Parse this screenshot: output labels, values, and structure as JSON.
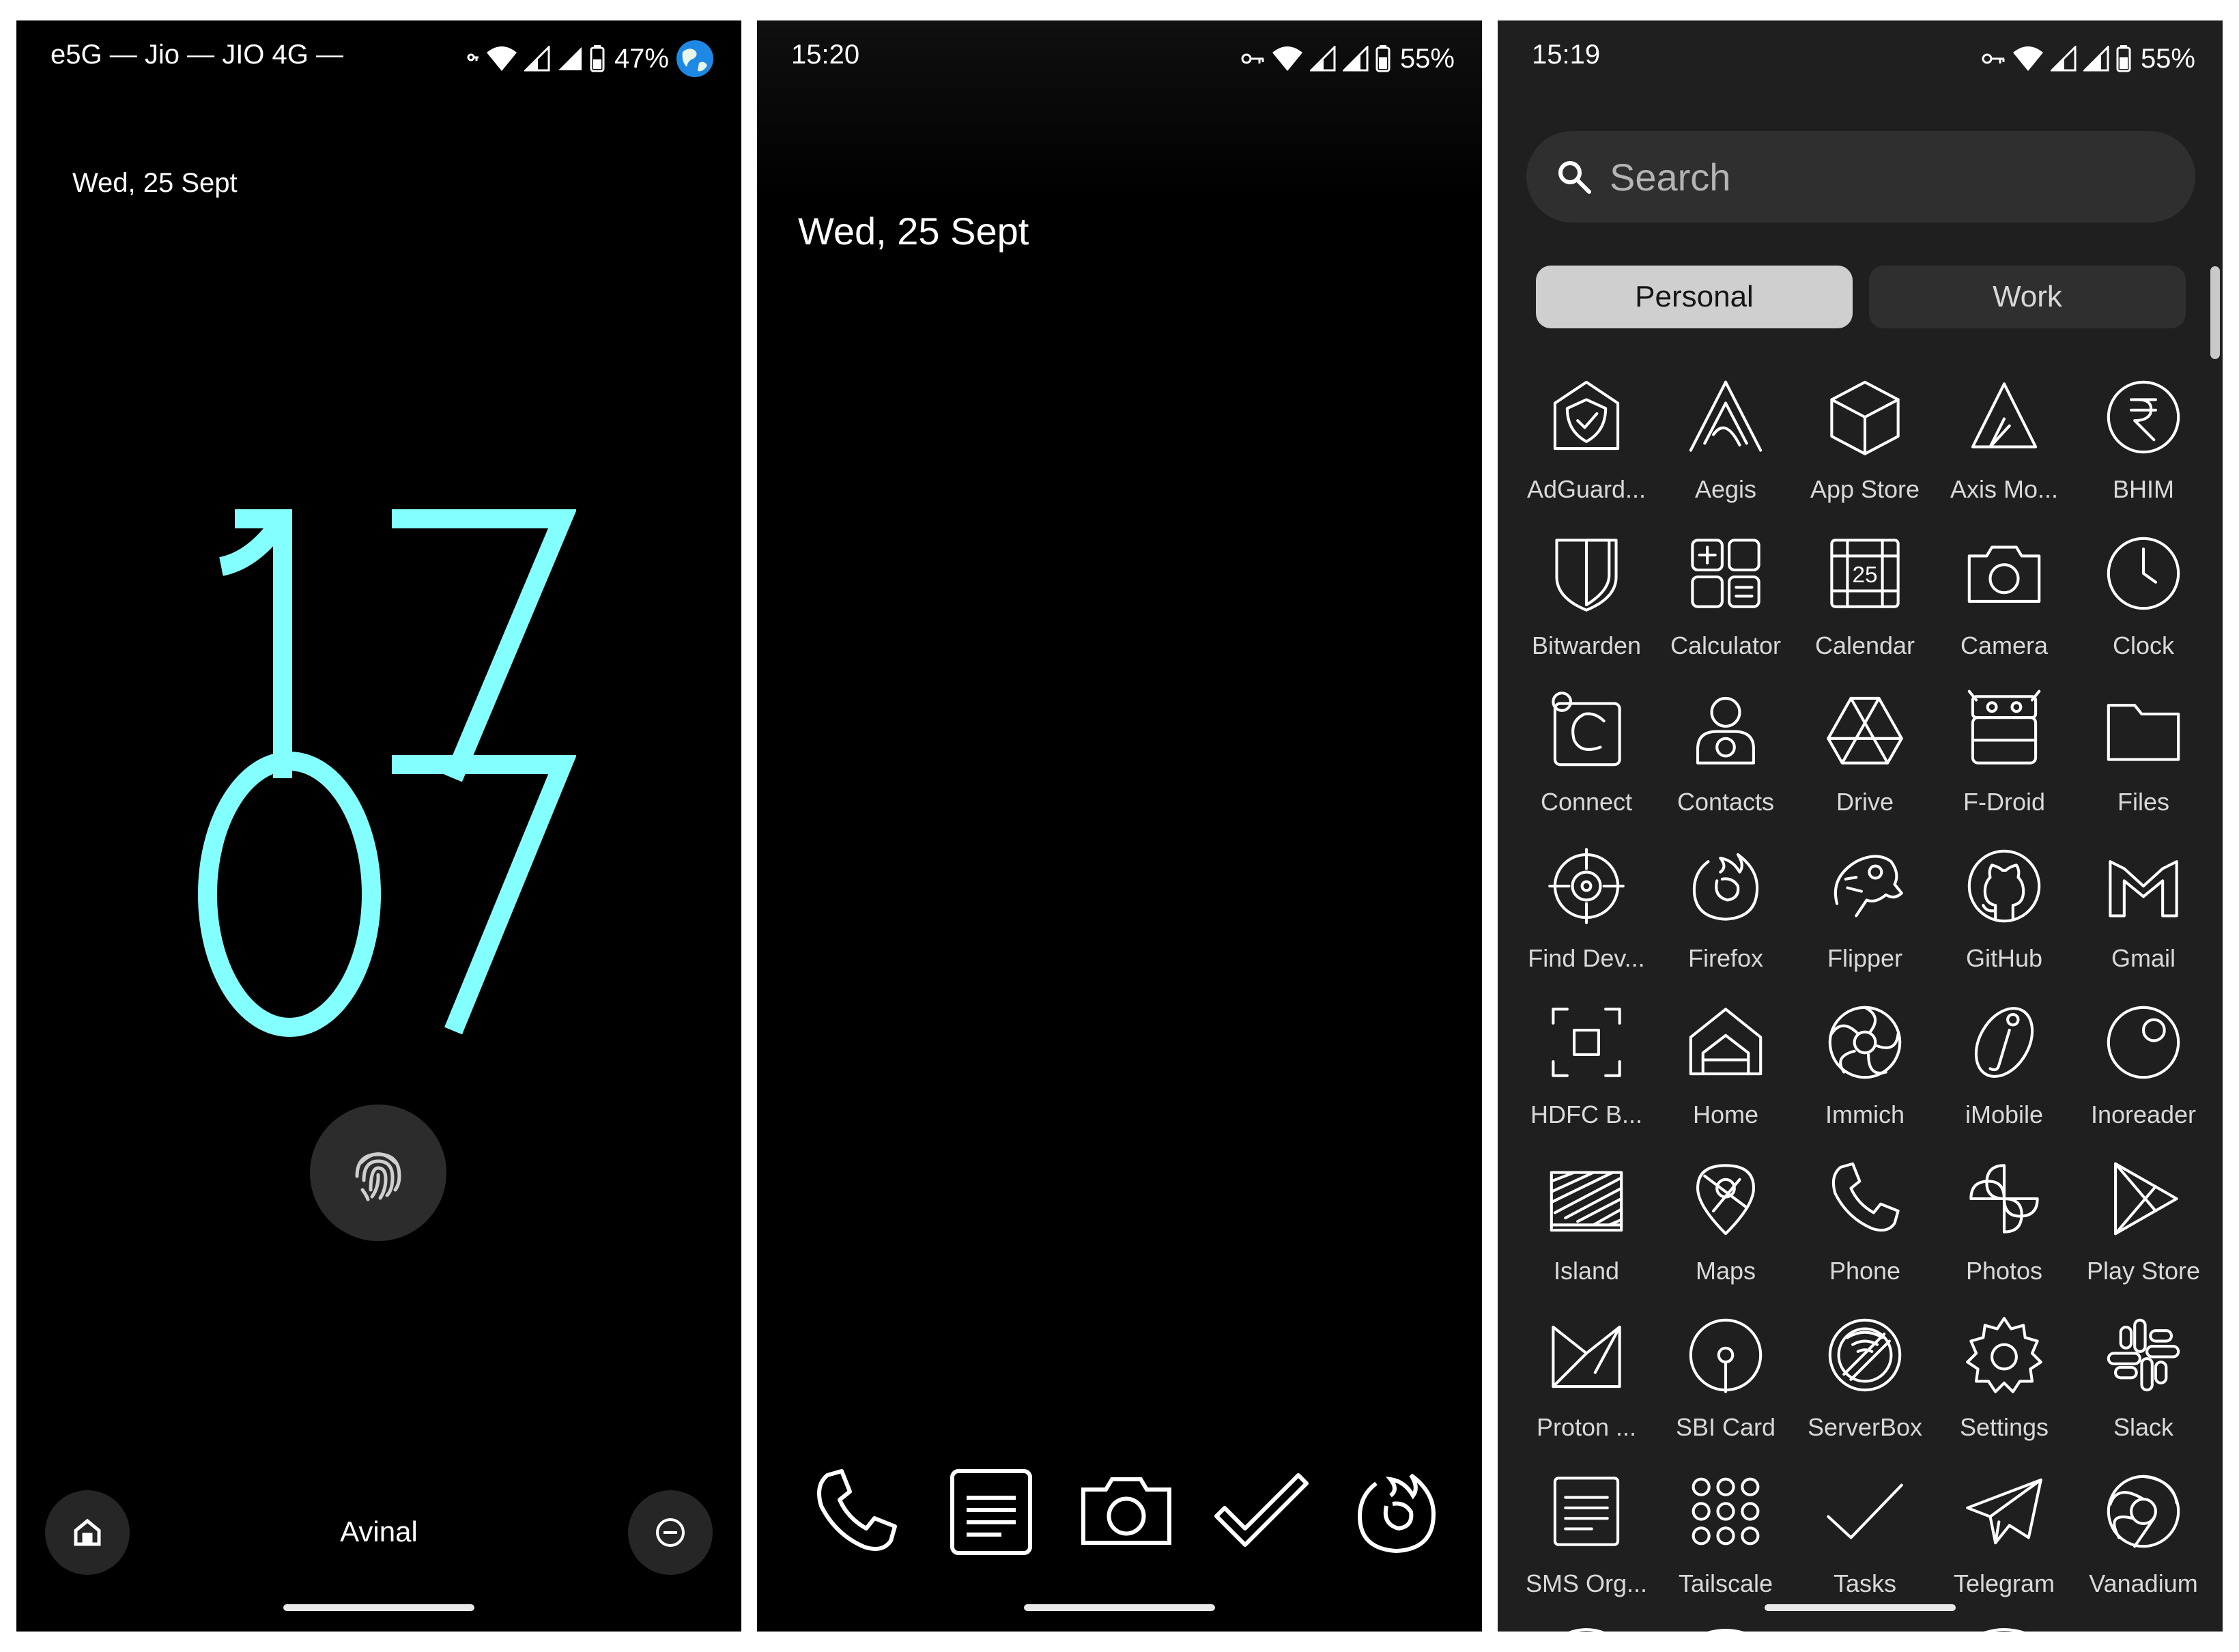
{
  "lock_screen": {
    "status": {
      "carrier": "e5G — Jio — JIO 4G —",
      "battery": "47%",
      "icons": [
        "vpn-key-icon",
        "wifi-icon",
        "signal-icon",
        "signal-icon",
        "battery-icon",
        "earth-avatar-icon"
      ]
    },
    "date": "Wed, 25 Sept",
    "clock": {
      "hours": "17",
      "minutes": "07",
      "color": "#84ffff"
    },
    "fingerprint_icon": "fingerprint-icon",
    "owner": "Avinal",
    "left_shortcut_icon": "home-icon",
    "right_shortcut_icon": "do-not-disturb-icon"
  },
  "home_screen": {
    "status": {
      "time": "15:20",
      "battery": "55%"
    },
    "date": "Wed, 25 Sept",
    "dock": [
      "phone-icon",
      "notes-icon",
      "camera-icon",
      "tasks-icon",
      "firefox-icon"
    ]
  },
  "app_drawer": {
    "status": {
      "time": "15:19",
      "battery": "55%"
    },
    "search": {
      "placeholder": "Search"
    },
    "tabs": [
      {
        "label": "Personal",
        "selected": true
      },
      {
        "label": "Work",
        "selected": false
      }
    ],
    "apps": [
      {
        "label": "AdGuard...",
        "icon": "adguard"
      },
      {
        "label": "Aegis",
        "icon": "aegis"
      },
      {
        "label": "App Store",
        "icon": "appstore"
      },
      {
        "label": "Axis Mo...",
        "icon": "axis"
      },
      {
        "label": "BHIM",
        "icon": "bhim"
      },
      {
        "label": "Bitwarden",
        "icon": "bitwarden"
      },
      {
        "label": "Calculator",
        "icon": "calculator"
      },
      {
        "label": "Calendar",
        "icon": "calendar"
      },
      {
        "label": "Camera",
        "icon": "camera"
      },
      {
        "label": "Clock",
        "icon": "clock"
      },
      {
        "label": "Connect",
        "icon": "connect"
      },
      {
        "label": "Contacts",
        "icon": "contacts"
      },
      {
        "label": "Drive",
        "icon": "drive"
      },
      {
        "label": "F-Droid",
        "icon": "fdroid"
      },
      {
        "label": "Files",
        "icon": "files"
      },
      {
        "label": "Find Dev...",
        "icon": "finddevice"
      },
      {
        "label": "Firefox",
        "icon": "firefox"
      },
      {
        "label": "Flipper",
        "icon": "flipper"
      },
      {
        "label": "GitHub",
        "icon": "github"
      },
      {
        "label": "Gmail",
        "icon": "gmail"
      },
      {
        "label": "HDFC B...",
        "icon": "hdfc"
      },
      {
        "label": "Home",
        "icon": "home"
      },
      {
        "label": "Immich",
        "icon": "immich"
      },
      {
        "label": "iMobile",
        "icon": "imobile"
      },
      {
        "label": "Inoreader",
        "icon": "inoreader"
      },
      {
        "label": "Island",
        "icon": "island"
      },
      {
        "label": "Maps",
        "icon": "maps"
      },
      {
        "label": "Phone",
        "icon": "phone"
      },
      {
        "label": "Photos",
        "icon": "photos"
      },
      {
        "label": "Play Store",
        "icon": "playstore"
      },
      {
        "label": "Proton ...",
        "icon": "proton"
      },
      {
        "label": "SBI Card",
        "icon": "sbicard"
      },
      {
        "label": "ServerBox",
        "icon": "serverbox"
      },
      {
        "label": "Settings",
        "icon": "settings"
      },
      {
        "label": "Slack",
        "icon": "slack"
      },
      {
        "label": "SMS Org...",
        "icon": "sms"
      },
      {
        "label": "Tailscale",
        "icon": "tailscale"
      },
      {
        "label": "Tasks",
        "icon": "tasks"
      },
      {
        "label": "Telegram",
        "icon": "telegram"
      },
      {
        "label": "Vanadium",
        "icon": "vanadium"
      }
    ]
  }
}
